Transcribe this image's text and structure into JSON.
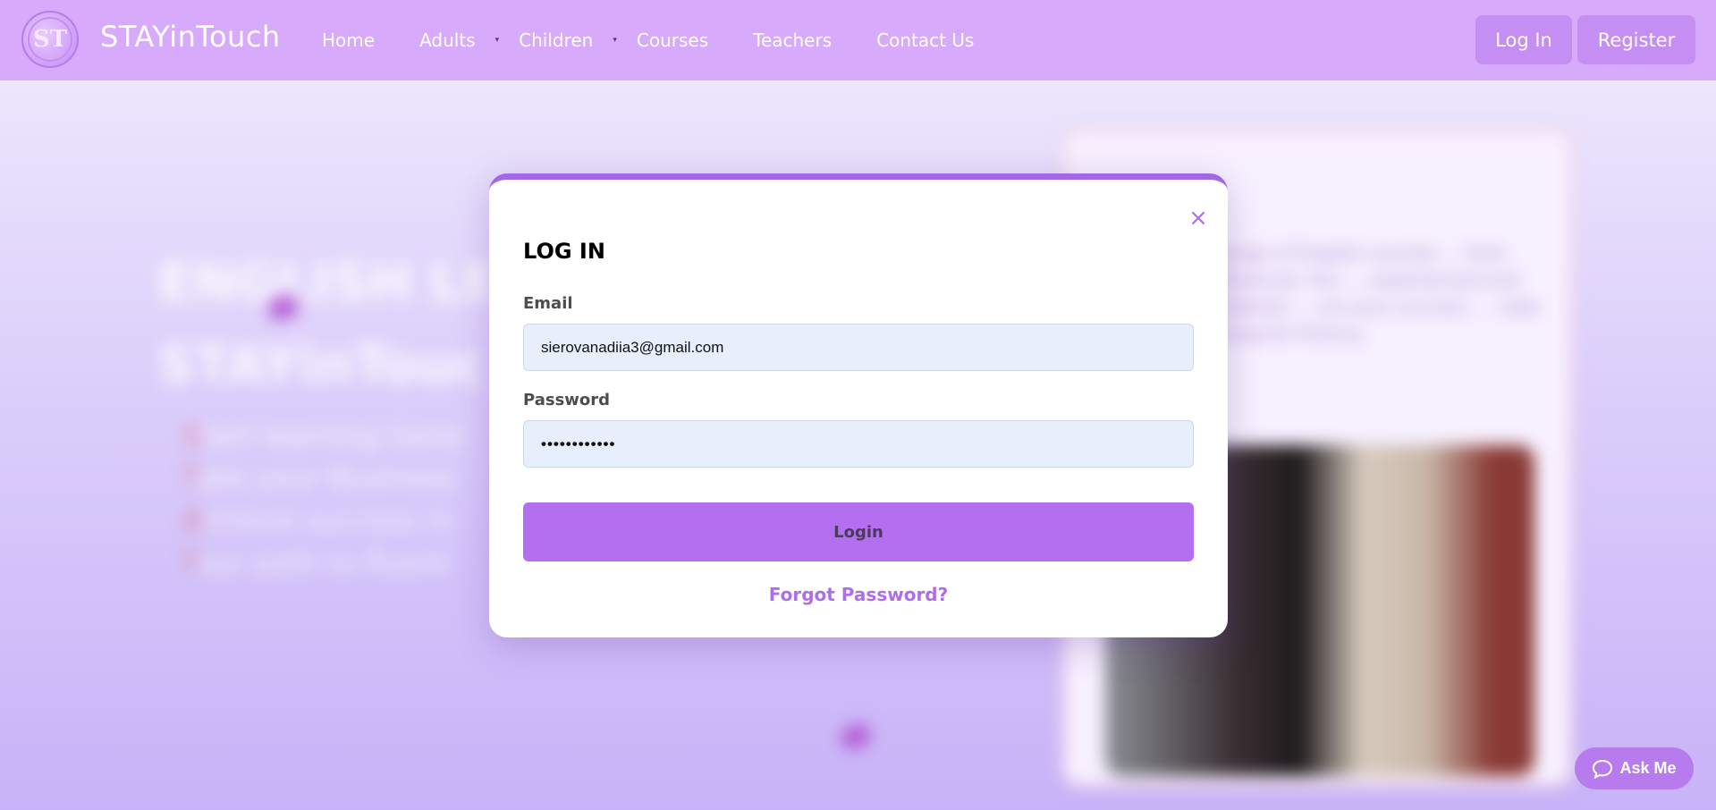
{
  "brand": {
    "name": "STAYinTouch",
    "logo_text": "ST"
  },
  "nav": {
    "items": [
      {
        "label": "Home",
        "has_dropdown": false
      },
      {
        "label": "Adults",
        "has_dropdown": true
      },
      {
        "label": "Children",
        "has_dropdown": true
      },
      {
        "label": "Courses",
        "has_dropdown": false
      },
      {
        "label": "Teachers",
        "has_dropdown": false
      },
      {
        "label": "Contact Us",
        "has_dropdown": false
      }
    ],
    "caret": "▾",
    "login_label": "Log In",
    "register_label": "Register"
  },
  "background": {
    "hero_title_line1": "ENGLISH LES",
    "hero_title_line2": "STAYinTouc",
    "hero_list": [
      {
        "first": "S",
        "rest": "tart learning Gene"
      },
      {
        "first": "T",
        "rest": "ake your Business"
      },
      {
        "first": "A",
        "rest": "chieve success in"
      },
      {
        "first": "Y",
        "rest": "our path to fluent"
      }
    ],
    "card_text": "...ses offer a range of English courses ... from beginner to advanced. Our ... experienced and provide personalized ... ure your success. ... take the first step towards fluency."
  },
  "modal": {
    "title": "LOG IN",
    "close_icon": "×",
    "email_label": "Email",
    "email_value": "sierovanadiia3@gmail.com",
    "password_label": "Password",
    "password_value": "••••••••••••",
    "login_button": "Login",
    "forgot_link": "Forgot Password?"
  },
  "ask_me": {
    "label": "Ask Me"
  },
  "colors": {
    "navbar": "#d8aafc",
    "accent": "#b46ff0",
    "modal_top_border": "#a268e8",
    "link": "#b06de8",
    "input_bg": "#e8effc"
  }
}
